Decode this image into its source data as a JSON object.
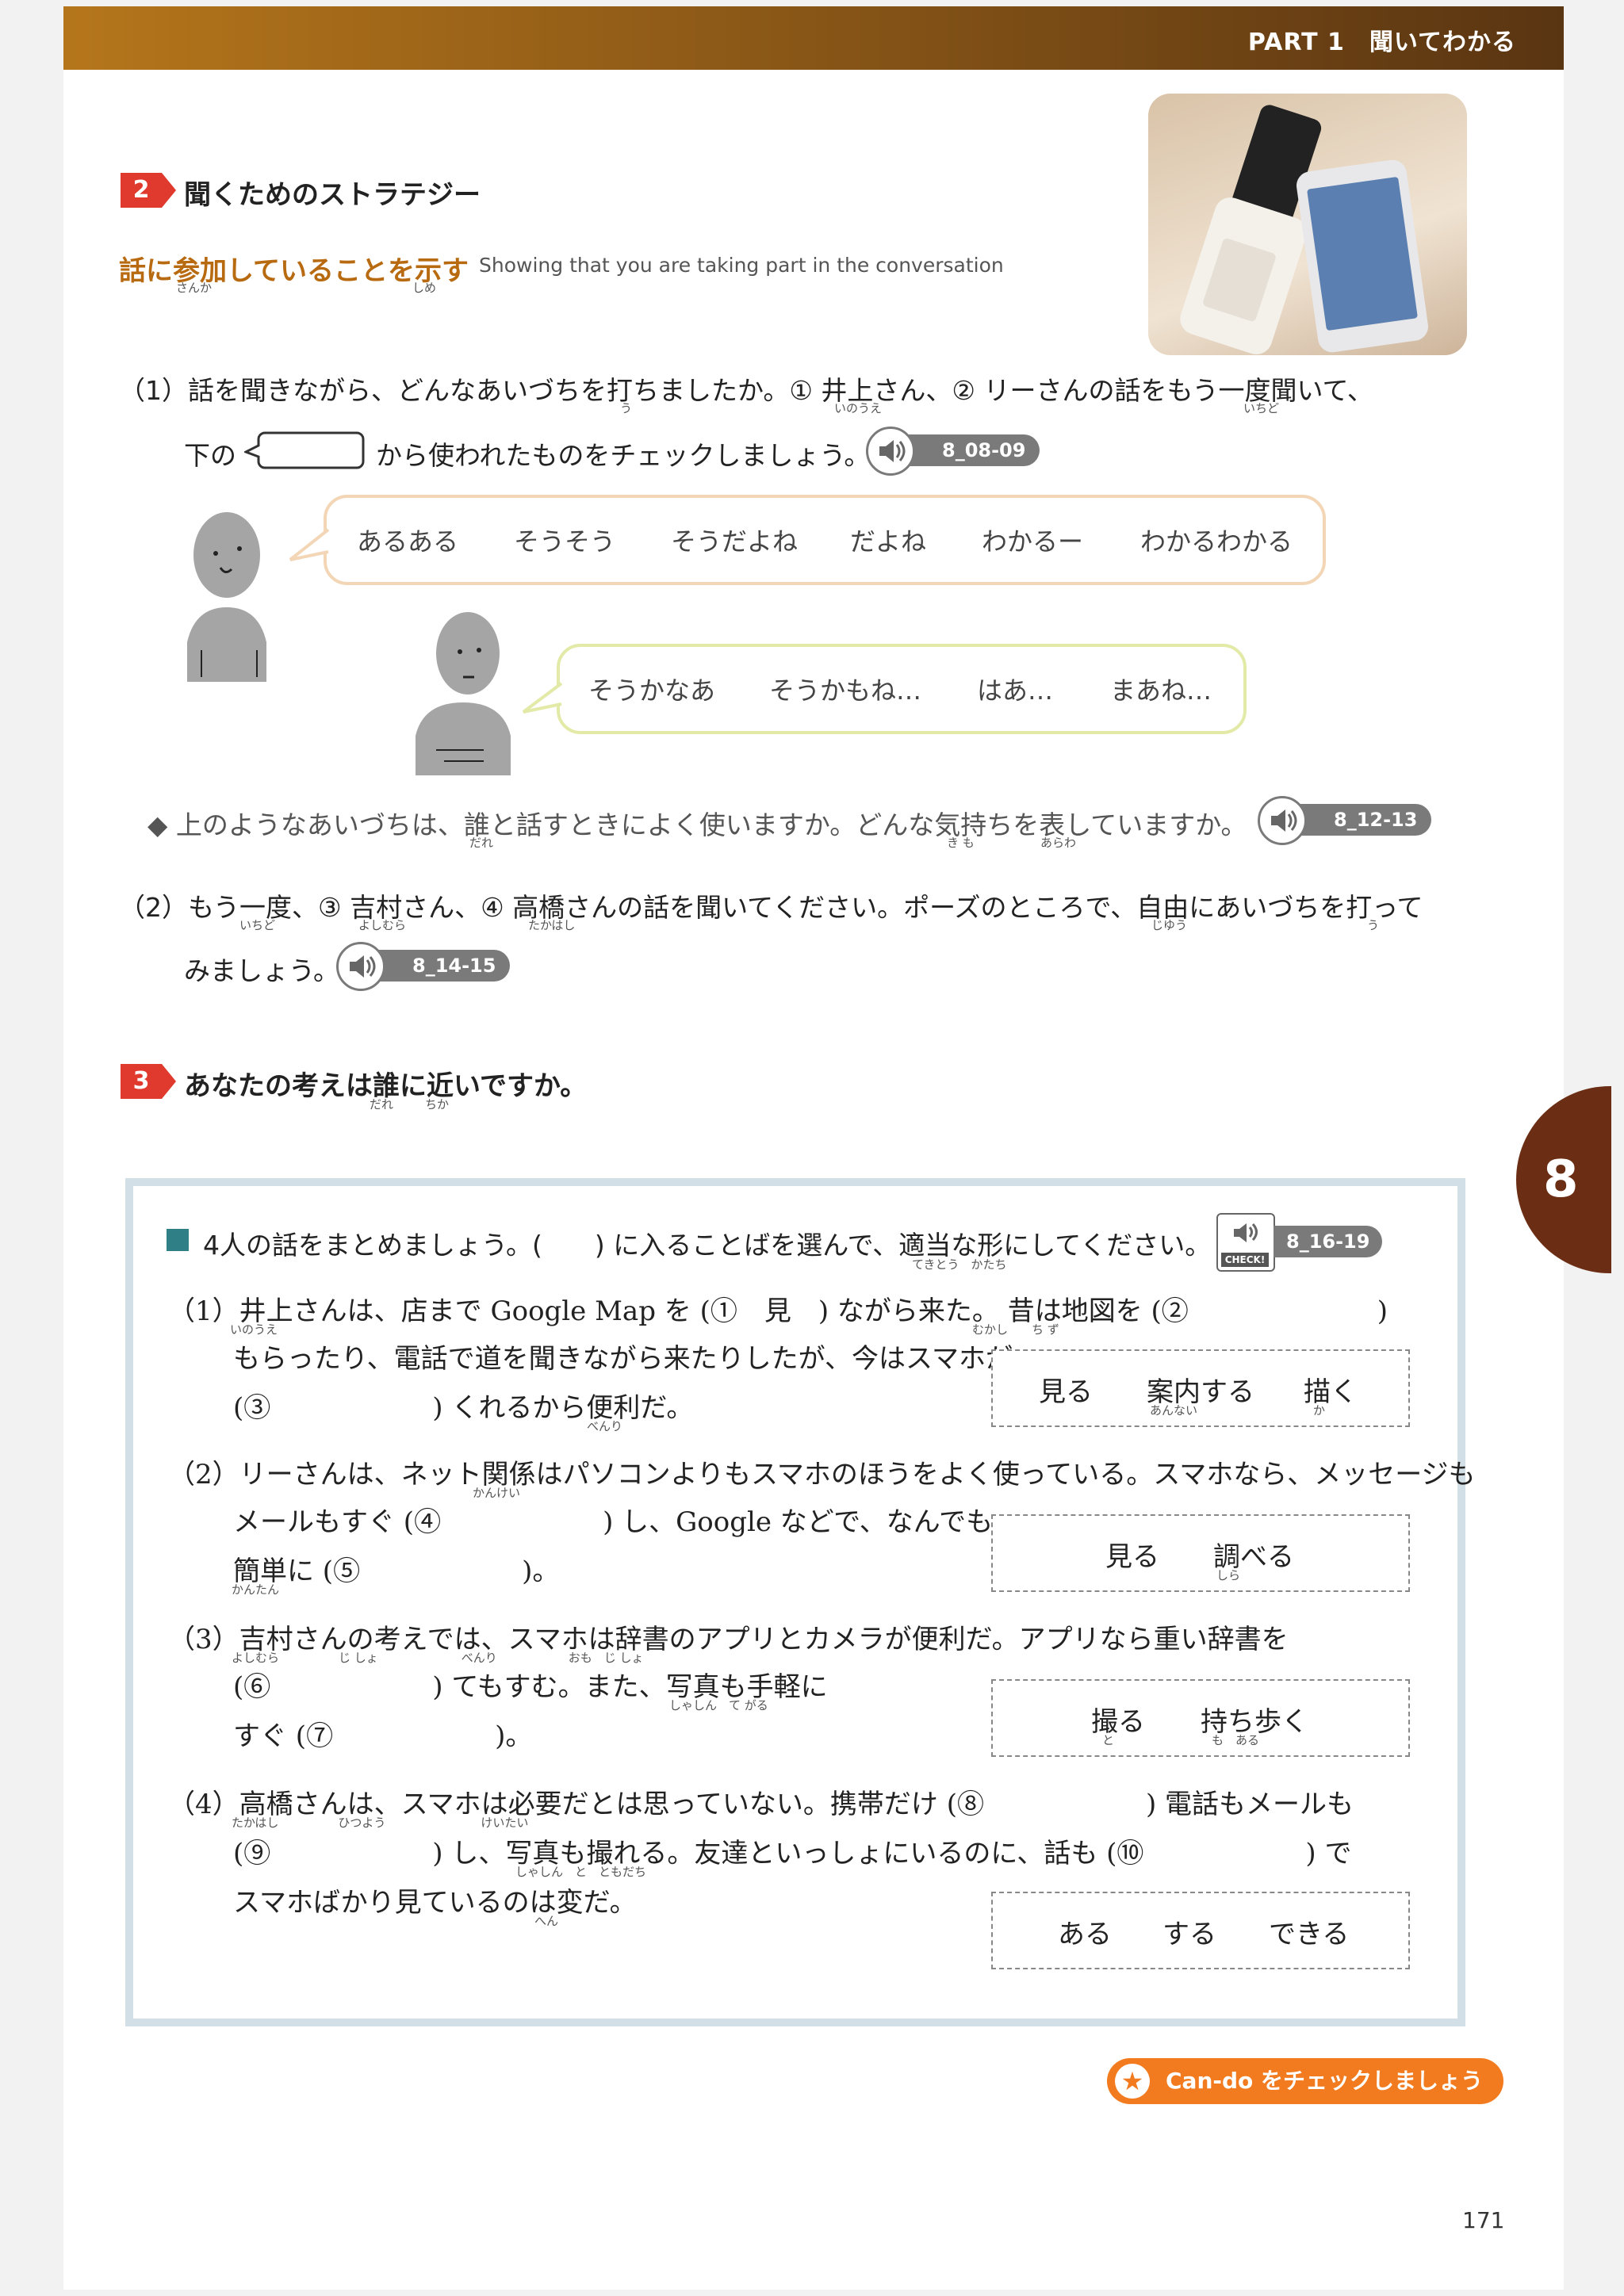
{
  "header": {
    "title": "PART 1　聞いてわかる"
  },
  "section2": {
    "number": "2",
    "title": "聞くためのストラテジー",
    "subtitle": "話に参加していることを示す",
    "subtitle_ruby_1": "さんか",
    "subtitle_ruby_2": "しめ",
    "subtitle_en": "Showing that you are taking part in the conversation",
    "q1_line1": "（1）話を聞きながら、どんなあいづちを打ちましたか。① 井上さん、② リーさんの話をもう一度聞いて、",
    "q1_ruby_u": "う",
    "q1_ruby_inoue": "いのうえ",
    "q1_ruby_ichido": "いちど",
    "q1_line2_pre": "下の",
    "q1_line2_post": "から使われたものをチェックしましょう。",
    "audio1": "8_08-09",
    "bubble1_words": [
      "あるある",
      "そうそう",
      "そうだよね",
      "だよね",
      "わかるー",
      "わかるわかる"
    ],
    "bubble2_words": [
      "そうかなあ",
      "そうかもね…",
      "はあ…",
      "まあね…"
    ],
    "bullet": "◆ 上のようなあいづちは、誰と話すときによく使いますか。どんな気持ちを表していますか。",
    "bullet_ruby_dare": "だれ",
    "bullet_ruby_kimo": "き も",
    "bullet_ruby_arawa": "あらわ",
    "audio2": "8_12-13",
    "q2_line1": "（2）もう一度、③ 吉村さん、④ 高橋さんの話を聞いてください。ポーズのところで、自由にあいづちを打って",
    "q2_ruby_ichido": "いちど",
    "q2_ruby_yoshimura": "よしむら",
    "q2_ruby_takahashi": "たかはし",
    "q2_ruby_jiyuu": "じゆう",
    "q2_ruby_u": "う",
    "q2_line2": "みましょう。",
    "audio3": "8_14-15"
  },
  "section3": {
    "number": "3",
    "title": "あなたの考えは誰に近いですか。",
    "ruby_dare": "だれ",
    "ruby_chika": "ちか",
    "instruction": "4人の話をまとめましょう。(　　) に入ることばを選んで、適当な形にしてください。",
    "instruction_ruby": "てきとう　かたち",
    "check_label": "CHECK!",
    "audio4": "8_16-19",
    "items": [
      {
        "lines": [
          "（1）井上さんは、店まで Google Map を (①　見　) ながら来た。 昔は地図を (②　　　　　　　)",
          "もらったり、電話で道を聞きながら来たりしたが、今はスマホが",
          "(③　　　　　　) くれるから便利だ。"
        ],
        "ruby": [
          "いのうえ",
          "むかし　　ち ず",
          "べんり"
        ],
        "choices": [
          "見る",
          "案内する",
          "描く"
        ],
        "choice_ruby": [
          "",
          "あんない",
          "か"
        ]
      },
      {
        "lines": [
          "（2）リーさんは、ネット関係はパソコンよりもスマホのほうをよく使っている。スマホなら、メッセージも",
          "メールもすぐ (④　　　　　　) し、Google などで、なんでも",
          "簡単に (⑤　　　　　　)。"
        ],
        "ruby": [
          "かんけい",
          "",
          "かんたん"
        ],
        "choices": [
          "見る",
          "調べる"
        ],
        "choice_ruby": [
          "",
          "しら"
        ]
      },
      {
        "lines": [
          "（3）吉村さんの考えでは、スマホは辞書のアプリとカメラが便利だ。アプリなら重い辞書を",
          "(⑥　　　　　　) てもすむ。また、写真も手軽に",
          "すぐ (⑦　　　　　　)。"
        ],
        "ruby": [
          "よしむら　　　　　じ しょ　　　　　　　べんり　　　　　　おも　じ しょ",
          "しゃしん　て がる",
          ""
        ],
        "choices": [
          "撮る",
          "持ち歩く"
        ],
        "choice_ruby": [
          "と",
          "も　ある"
        ]
      },
      {
        "lines": [
          "（4）高橋さんは、スマホは必要だとは思っていない。携帯だけ (⑧　　　　　　) 電話もメールも",
          "(⑨　　　　　　) し、写真も撮れる。友達といっしょにいるのに、話も (⑩　　　　　　) で",
          "スマホばかり見ているのは変だ。"
        ],
        "ruby": [
          "たかはし　　　　　ひつよう　　　　　　　　けいたい",
          "しゃしん　と　ともだち",
          "へん"
        ],
        "choices": [
          "ある",
          "する",
          "できる"
        ],
        "choice_ruby": [
          "",
          "",
          ""
        ]
      }
    ]
  },
  "cando": "Can-do をチェックしましょう",
  "chapter_tab": "8",
  "page_number": "171",
  "icons": [
    "speaker-icon",
    "star-icon",
    "person-icon",
    "phone-photo"
  ]
}
